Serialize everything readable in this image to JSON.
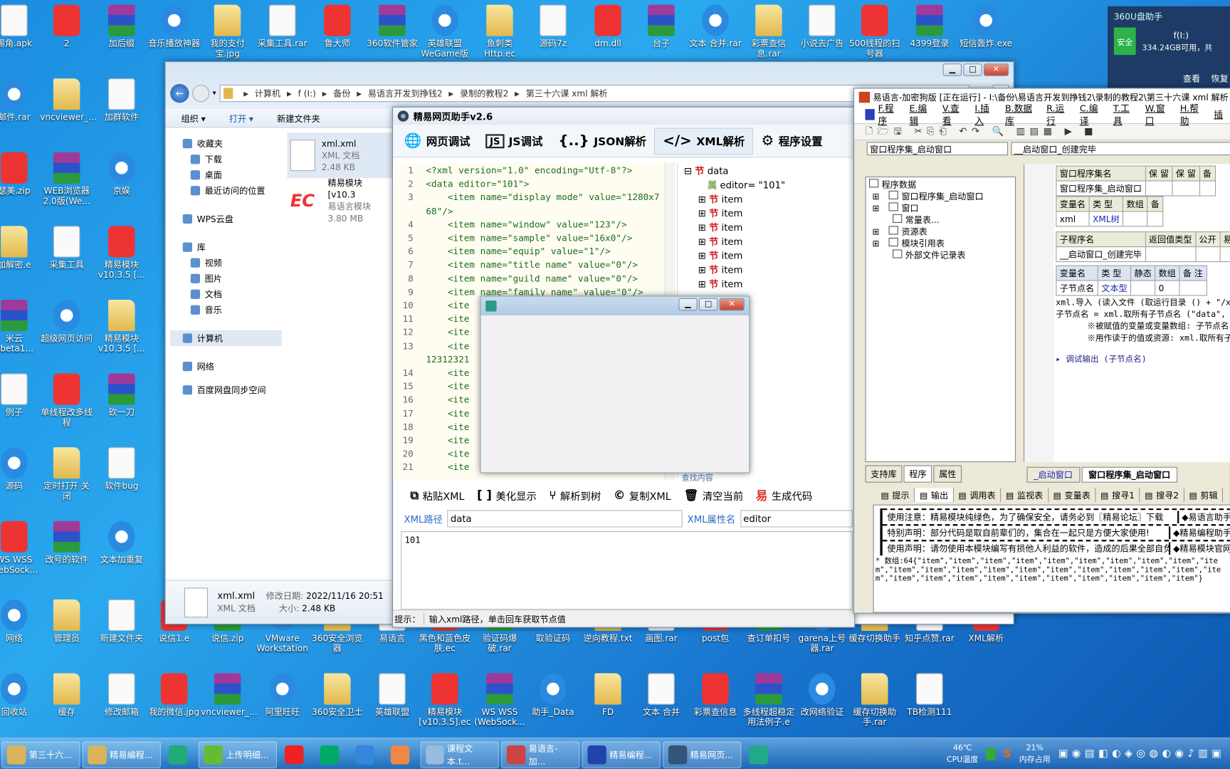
{
  "desktop_icons_top": [
    "锡角.apk",
    "2",
    "加后缀",
    "音乐播放神器",
    "我的支付宝.jpg",
    "采集工具.rar",
    "鲁大师",
    "360软件管家",
    "英雄联盟WeGame版",
    "鱼刺类Http.ec",
    "源码7z",
    "dm.dll",
    "台子",
    "文本 合并.rar",
    "彩票查信息.rar",
    "小说去广告",
    "500线程的扫号器",
    "4399登录",
    "短信轰炸.exe"
  ],
  "desktop_icons_left": [
    "邮件.rar",
    "vncviewer_...",
    "加群软件",
    "瑟美.zip",
    "WEB浏览器2.0版(We...",
    "京娱",
    "加解密.e",
    "采集工具",
    "精易模块v10.3.5 [...",
    "米云0beta1...",
    "超级网页访问",
    "精易模块v10.3.5 [...",
    "例子",
    "单线程改多线程",
    "砍一刀",
    "源码",
    "定时打开 关闭",
    "软件bug",
    "WS WSS WebSock...",
    "改号的软件",
    "文本加重复"
  ],
  "desktop_icons_row2": [
    "网络",
    "管理员",
    "新建文件夹",
    "说信1.e",
    "说信.zip",
    "VMware Workstation",
    "360安全浏览器",
    "易语言",
    "黑色和蓝色皮肤.ec",
    "验证码爆破.rar",
    "取验证码",
    "逆向教程.txt",
    "画图.rar",
    "post包",
    "查订单扣号",
    "garena上号器.rar",
    "缓存切换助手",
    "知乎点赞.rar",
    "XML解析"
  ],
  "desktop_icons_row3": [
    "回收站",
    "缓存",
    "修改邮箱",
    "我的微信.jpg",
    "vncviewer_...",
    "阿里旺旺",
    "360安全卫士",
    "英雄联盟",
    "精易模块[v10.3.5].ec",
    "WS WSS (WebSock...",
    "助手_Data",
    "FD",
    "文本 合并",
    "彩票查信息",
    "多线程超稳定用法例子.e",
    "改网络验证",
    "缓存切换助手.rar",
    "TB检测111"
  ],
  "widget_360": {
    "title": "360U盘助手",
    "badge": "安全",
    "drive": "f(I:)",
    "free": "334.24GB可用，共",
    "btn1": "查看",
    "btn2": "恢复"
  },
  "explorer": {
    "breadcrumb": [
      "计算机",
      "f (I:)",
      "备份",
      "易语言开发到挣钱2",
      "录制的教程2",
      "第三十六课  xml 解析"
    ],
    "search_placeholder": "搜",
    "commands": [
      "组织 ▾",
      "打开 ▾",
      "新建文件夹"
    ],
    "nav": [
      {
        "label": "收藏夹",
        "icon": "star-icon"
      },
      {
        "label": "下载",
        "icon": "download-icon"
      },
      {
        "label": "桌面",
        "icon": "desktop-icon"
      },
      {
        "label": "最近访问的位置",
        "icon": "recent-icon"
      },
      {
        "label": "WPS云盘",
        "icon": "cloud-icon"
      },
      {
        "label": "库",
        "icon": "library-icon"
      },
      {
        "label": "视频",
        "icon": "video-icon"
      },
      {
        "label": "图片",
        "icon": "picture-icon"
      },
      {
        "label": "文档",
        "icon": "document-icon"
      },
      {
        "label": "音乐",
        "icon": "music-icon"
      },
      {
        "label": "计算机",
        "icon": "computer-icon"
      },
      {
        "label": "网络",
        "icon": "network-icon"
      },
      {
        "label": "百度网盘同步空间",
        "icon": "baidu-icon"
      }
    ],
    "files": [
      {
        "name": "xml.xml",
        "type": "XML 文档",
        "size": "2.48 KB"
      },
      {
        "name": "精易模块[v10.3",
        "type": "易语言模块",
        "size": "3.80 MB"
      }
    ],
    "details": {
      "name": "xml.xml",
      "modified_label": "修改日期:",
      "modified": "2022/11/16 20:51",
      "type": "XML 文档",
      "size_label": "大小:",
      "size": "2.48 KB"
    }
  },
  "tool": {
    "title": "精易网页助手v2.6",
    "tabs": [
      "网页调试",
      "JS调试",
      "JSON解析",
      "XML解析",
      "程序设置"
    ],
    "active_tab": "XML解析",
    "code_lines": [
      [
        "1",
        "<?xml version=\"1.0\" encoding=\"Utf-8\"?>"
      ],
      [
        "2",
        "<data editor=\"101\">"
      ],
      [
        "3",
        "    <item name=\"display mode\" value=\"1280x7"
      ],
      [
        "",
        "68\"/>"
      ],
      [
        "4",
        "    <item name=\"window\" value=\"123\"/>"
      ],
      [
        "5",
        "    <item name=\"sample\" value=\"16x0\"/>"
      ],
      [
        "6",
        "    <item name=\"equip\" value=\"1\"/>"
      ],
      [
        "7",
        "    <item name=\"title name\" value=\"0\"/>"
      ],
      [
        "8",
        "    <item name=\"guild name\" value=\"0\"/>"
      ],
      [
        "9",
        "    <item name=\"family name\" value=\"0\"/>"
      ],
      [
        "10",
        "    <ite"
      ],
      [
        "11",
        "    <ite"
      ],
      [
        "12",
        "    <ite"
      ],
      [
        "13",
        "    <ite"
      ],
      [
        "",
        "12312321"
      ],
      [
        "14",
        "    <ite"
      ],
      [
        "15",
        "    <ite"
      ],
      [
        "16",
        "    <ite"
      ],
      [
        "17",
        "    <ite"
      ],
      [
        "18",
        "    <ite"
      ],
      [
        "19",
        "    <ite"
      ],
      [
        "20",
        "    <ite"
      ],
      [
        "21",
        "    <ite"
      ]
    ],
    "tree": {
      "root": "data",
      "attr_tag": "属",
      "attr": "editor= \"101\"",
      "node_tag": "节",
      "children": [
        "item",
        "item",
        "item",
        "item",
        "item",
        "item",
        "item"
      ]
    },
    "find_label": "查找内容",
    "buttons": [
      "粘贴XML",
      "美化显示",
      "解析到树",
      "复制XML",
      "清空当前",
      "生成代码"
    ],
    "path_label": "XML路径",
    "path_value": "data",
    "attr_label": "XML属性名",
    "attr_value": "editor",
    "output": "101",
    "status_label": "提示：",
    "status_text": "输入xml路径，单击回车获取节点值"
  },
  "ide": {
    "title": "易语言-加密狗版 [正在运行] - I:\\备份\\易语言开发到挣钱2\\录制的教程2\\第三十六课  xml 解析",
    "menu": [
      "F.程序",
      "E.编辑",
      "V.查看",
      "I.插入",
      "B.数据库",
      "R.运行",
      "C.编译",
      "T.工具",
      "W.窗口",
      "H.帮助",
      "插"
    ],
    "combo1": "窗口程序集_启动窗口",
    "combo2": "__启动窗口_创建完毕",
    "tree": [
      "程序数据",
      "窗口程序集_启动窗口",
      "窗口",
      "常量表...",
      "资源表",
      "模块引用表",
      "外部文件记录表"
    ],
    "panel_tabs": [
      "支持库",
      "程序",
      "属性"
    ],
    "grid1": {
      "headers": [
        "窗口程序集名",
        "保 留",
        "保 留",
        "备"
      ],
      "row": [
        "窗口程序集_启动窗口",
        "",
        "",
        ""
      ]
    },
    "grid2": {
      "headers": [
        "变量名",
        "类 型",
        "数组",
        "备"
      ],
      "row": [
        "xml",
        "XML树",
        "",
        ""
      ]
    },
    "grid3": {
      "headers": [
        "子程序名",
        "返回值类型",
        "公开",
        "易"
      ],
      "row": [
        "__启动窗口_创建完毕",
        "",
        "",
        ""
      ]
    },
    "grid4": {
      "headers": [
        "变量名",
        "类 型",
        "静态",
        "数组",
        "备 注"
      ],
      "row": [
        "子节点名",
        "文本型",
        "",
        "0",
        ""
      ]
    },
    "code": [
      "xml.导入 (读入文件 (取运行目录 () + \"/x",
      "子节点名 = xml.取所有子节点名 (\"data\",",
      "※被赋值的变量或变量数组: 子节点名",
      "※用作读于的值或资源: xml.取所有子",
      "▸ 调试输出 (子节点名)"
    ],
    "doc_tabs": [
      "_启动窗口",
      "窗口程序集_启动窗口"
    ],
    "bottom_tabs": [
      "提示",
      "输出",
      "调用表",
      "监视表",
      "变量表",
      "搜寻1",
      "搜寻2",
      "剪辑"
    ],
    "output_lines": [
      [
        "使用注意：精易模块纯绿色，为了确保安全，请务必到〖精易论坛〗下载",
        "◆易语言助手"
      ],
      [
        "特别声明：部分代码是取自前辈们的，集合在一起只是方便大家使用!",
        "◆精易编程助手"
      ],
      [
        "使用声明：请勿使用本模块编写有损他人利益的软件，造成的后果全部自负",
        "◆精易模块官网"
      ]
    ],
    "debug_output": "* 数组:64{\"item\",\"item\",\"item\",\"item\",\"item\",\"item\",\"item\",\"item\",\"item\",\"item\",\"item\",\"item\",\"item\",\"item\",\"item\",\"item\",\"item\",\"item\",\"item\",\"item\",\"item\",\"item\",\"item\",\"item\",\"item\",\"item\",\"item\",\"item\",\"item\",\"item\",\"item\"}"
  },
  "taskbar": {
    "items": [
      "第三十六...",
      "精易编程...",
      "",
      "上传明细...",
      "",
      "",
      "",
      "",
      "课程文本.t...",
      "易语言-加...",
      "精易编程...",
      "精易网页...",
      ""
    ],
    "cpu_temp": "46℃",
    "cpu_label": "CPU温度",
    "mem": "21%",
    "mem_label": "内存占用"
  },
  "colors": {
    "accent": "#2b6cc4",
    "tree_red": "#d02020"
  }
}
